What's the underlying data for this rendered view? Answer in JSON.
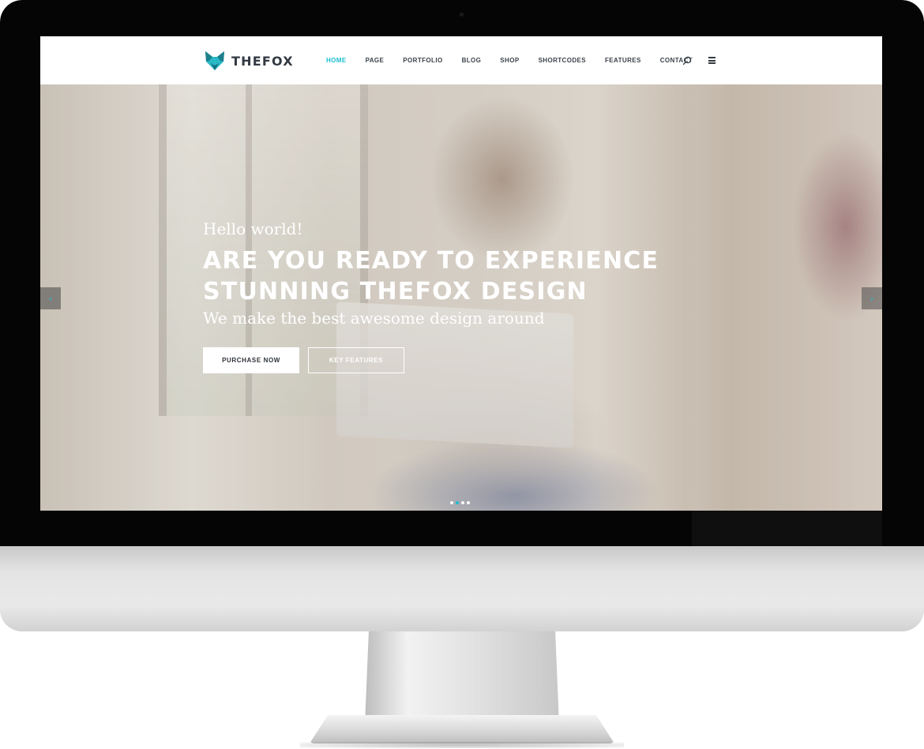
{
  "site": {
    "brand_name": "THEFOX",
    "nav": [
      {
        "label": "HOME",
        "active": true
      },
      {
        "label": "PAGE",
        "active": false
      },
      {
        "label": "PORTFOLIO",
        "active": false
      },
      {
        "label": "BLOG",
        "active": false
      },
      {
        "label": "SHOP",
        "active": false
      },
      {
        "label": "SHORTCODES",
        "active": false
      },
      {
        "label": "FEATURES",
        "active": false
      },
      {
        "label": "CONTACT",
        "active": false
      }
    ],
    "icons": {
      "search": "search-icon",
      "menu": "hamburger-menu-icon",
      "logo": "fox-logo-icon"
    }
  },
  "hero": {
    "eyebrow": "Hello world!",
    "heading_line1": "ARE YOU READY TO EXPERIENCE",
    "heading_line2": "STUNNING THEFOX DESIGN",
    "subtitle": "We make the best awesome design around",
    "primary_button": "PURCHASE NOW",
    "secondary_button": "KEY FEATURES",
    "prev_arrow": "‹",
    "next_arrow": "›",
    "slide_count": 4,
    "active_slide": 2
  },
  "colors": {
    "accent": "#1cbfd0",
    "text_dark": "#323a43",
    "logo_teal": "#29b8c6",
    "logo_dark": "#1d7f8c"
  }
}
